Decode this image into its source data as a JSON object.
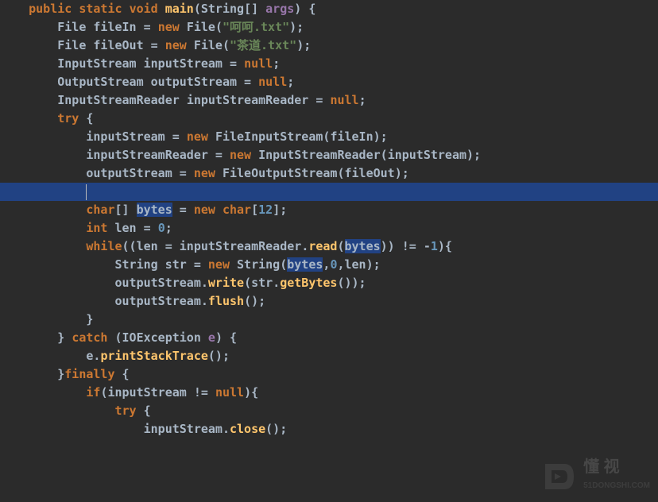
{
  "colors": {
    "background": "#2b2b2b",
    "keyword": "#cc7832",
    "string": "#6a8759",
    "number": "#6897bb",
    "method": "#ffc66d",
    "identifier": "#a9b7c6",
    "selection": "#214283",
    "highlight": "#32593d"
  },
  "cursor_position": {
    "line": 12,
    "column": 12
  },
  "highlighted_line": 12,
  "highlighted_identifier": "bytes",
  "code": {
    "lines": [
      {
        "indent": 4,
        "tokens": [
          [
            "kw",
            "public"
          ],
          [
            "sp",
            " "
          ],
          [
            "kw",
            "static"
          ],
          [
            "sp",
            " "
          ],
          [
            "kw",
            "void"
          ],
          [
            "sp",
            " "
          ],
          [
            "method",
            "main"
          ],
          [
            "punct",
            "("
          ],
          [
            "class",
            "String"
          ],
          [
            "punct",
            "[] "
          ],
          [
            "param",
            "args"
          ],
          [
            "punct",
            ") {"
          ]
        ]
      },
      {
        "indent": 8,
        "tokens": [
          [
            "class",
            "File"
          ],
          [
            "sp",
            " "
          ],
          [
            "ident",
            "fileIn"
          ],
          [
            "sp",
            " = "
          ],
          [
            "kw",
            "new"
          ],
          [
            "sp",
            " "
          ],
          [
            "class",
            "File"
          ],
          [
            "punct",
            "("
          ],
          [
            "str",
            "\"呵呵.txt\""
          ],
          [
            "punct",
            ");"
          ]
        ]
      },
      {
        "indent": 8,
        "tokens": [
          [
            "class",
            "File"
          ],
          [
            "sp",
            " "
          ],
          [
            "ident",
            "fileOut"
          ],
          [
            "sp",
            " = "
          ],
          [
            "kw",
            "new"
          ],
          [
            "sp",
            " "
          ],
          [
            "class",
            "File"
          ],
          [
            "punct",
            "("
          ],
          [
            "str",
            "\"茶道.txt\""
          ],
          [
            "punct",
            ");"
          ]
        ]
      },
      {
        "indent": 0,
        "tokens": []
      },
      {
        "indent": 8,
        "tokens": [
          [
            "class",
            "InputStream"
          ],
          [
            "sp",
            " "
          ],
          [
            "ident",
            "inputStream"
          ],
          [
            "sp",
            " = "
          ],
          [
            "kw",
            "null"
          ],
          [
            "punct",
            ";"
          ]
        ]
      },
      {
        "indent": 8,
        "tokens": [
          [
            "class",
            "OutputStream"
          ],
          [
            "sp",
            " "
          ],
          [
            "ident",
            "outputStream"
          ],
          [
            "sp",
            " = "
          ],
          [
            "kw",
            "null"
          ],
          [
            "punct",
            ";"
          ]
        ]
      },
      {
        "indent": 8,
        "tokens": [
          [
            "class",
            "InputStreamReader"
          ],
          [
            "sp",
            " "
          ],
          [
            "ident",
            "inputStreamReader"
          ],
          [
            "sp",
            " = "
          ],
          [
            "kw",
            "null"
          ],
          [
            "punct",
            ";"
          ]
        ]
      },
      {
        "indent": 0,
        "tokens": []
      },
      {
        "indent": 8,
        "tokens": [
          [
            "kw",
            "try"
          ],
          [
            "sp",
            " {"
          ]
        ]
      },
      {
        "indent": 12,
        "tokens": [
          [
            "ident",
            "inputStream"
          ],
          [
            "sp",
            " = "
          ],
          [
            "kw",
            "new"
          ],
          [
            "sp",
            " "
          ],
          [
            "class",
            "FileInputStream"
          ],
          [
            "punct",
            "("
          ],
          [
            "ident",
            "fileIn"
          ],
          [
            "punct",
            ");"
          ]
        ]
      },
      {
        "indent": 12,
        "tokens": [
          [
            "ident",
            "inputStreamReader"
          ],
          [
            "sp",
            " = "
          ],
          [
            "kw",
            "new"
          ],
          [
            "sp",
            " "
          ],
          [
            "class",
            "InputStreamReader"
          ],
          [
            "punct",
            "("
          ],
          [
            "ident",
            "inputStream"
          ],
          [
            "punct",
            ");"
          ]
        ]
      },
      {
        "indent": 12,
        "tokens": [
          [
            "ident",
            "outputStream"
          ],
          [
            "sp",
            " = "
          ],
          [
            "kw",
            "new"
          ],
          [
            "sp",
            " "
          ],
          [
            "class",
            "FileOutputStream"
          ],
          [
            "punct",
            "("
          ],
          [
            "ident",
            "fileOut"
          ],
          [
            "punct",
            ");"
          ]
        ]
      },
      {
        "indent": 12,
        "tokens": [],
        "highlighted": true,
        "cursor": true
      },
      {
        "indent": 12,
        "tokens": [
          [
            "kw",
            "char"
          ],
          [
            "punct",
            "[] "
          ],
          [
            "hl-var",
            "bytes"
          ],
          [
            "sp",
            " = "
          ],
          [
            "kw",
            "new"
          ],
          [
            "sp",
            " "
          ],
          [
            "kw",
            "char"
          ],
          [
            "punct",
            "["
          ],
          [
            "num",
            "12"
          ],
          [
            "punct",
            "];"
          ]
        ]
      },
      {
        "indent": 12,
        "tokens": [
          [
            "kw",
            "int"
          ],
          [
            "sp",
            " "
          ],
          [
            "ident",
            "len"
          ],
          [
            "sp",
            " = "
          ],
          [
            "num",
            "0"
          ],
          [
            "punct",
            ";"
          ]
        ]
      },
      {
        "indent": 0,
        "tokens": []
      },
      {
        "indent": 12,
        "tokens": [
          [
            "kw",
            "while"
          ],
          [
            "punct",
            "(("
          ],
          [
            "ident",
            "len"
          ],
          [
            "sp",
            " = "
          ],
          [
            "ident",
            "inputStreamReader"
          ],
          [
            "punct",
            "."
          ],
          [
            "method",
            "read"
          ],
          [
            "punct",
            "("
          ],
          [
            "hl-usage",
            "bytes"
          ],
          [
            "punct",
            ")) != -"
          ],
          [
            "num",
            "1"
          ],
          [
            "punct",
            "){"
          ]
        ]
      },
      {
        "indent": 16,
        "tokens": [
          [
            "class",
            "String"
          ],
          [
            "sp",
            " "
          ],
          [
            "ident",
            "str"
          ],
          [
            "sp",
            " = "
          ],
          [
            "kw",
            "new"
          ],
          [
            "sp",
            " "
          ],
          [
            "class",
            "String"
          ],
          [
            "punct",
            "("
          ],
          [
            "hl-usage",
            "bytes"
          ],
          [
            "punct",
            ","
          ],
          [
            "num",
            "0"
          ],
          [
            "punct",
            ","
          ],
          [
            "ident",
            "len"
          ],
          [
            "punct",
            ");"
          ]
        ]
      },
      {
        "indent": 0,
        "tokens": []
      },
      {
        "indent": 16,
        "tokens": [
          [
            "ident",
            "outputStream"
          ],
          [
            "punct",
            "."
          ],
          [
            "method",
            "write"
          ],
          [
            "punct",
            "("
          ],
          [
            "ident",
            "str"
          ],
          [
            "punct",
            "."
          ],
          [
            "method",
            "getBytes"
          ],
          [
            "punct",
            "());"
          ]
        ]
      },
      {
        "indent": 16,
        "tokens": [
          [
            "ident",
            "outputStream"
          ],
          [
            "punct",
            "."
          ],
          [
            "method",
            "flush"
          ],
          [
            "punct",
            "();"
          ]
        ]
      },
      {
        "indent": 12,
        "tokens": [
          [
            "punct",
            "}"
          ]
        ]
      },
      {
        "indent": 8,
        "tokens": [
          [
            "punct",
            "} "
          ],
          [
            "kw",
            "catch"
          ],
          [
            "sp",
            " ("
          ],
          [
            "class",
            "IOException"
          ],
          [
            "sp",
            " "
          ],
          [
            "param",
            "e"
          ],
          [
            "punct",
            ") {"
          ]
        ]
      },
      {
        "indent": 12,
        "tokens": [
          [
            "ident",
            "e"
          ],
          [
            "punct",
            "."
          ],
          [
            "method",
            "printStackTrace"
          ],
          [
            "punct",
            "();"
          ]
        ]
      },
      {
        "indent": 8,
        "tokens": [
          [
            "punct",
            "}"
          ],
          [
            "kw",
            "finally"
          ],
          [
            "sp",
            " {"
          ]
        ]
      },
      {
        "indent": 12,
        "tokens": [
          [
            "kw",
            "if"
          ],
          [
            "punct",
            "("
          ],
          [
            "ident",
            "inputStream"
          ],
          [
            "sp",
            " != "
          ],
          [
            "kw",
            "null"
          ],
          [
            "punct",
            "){"
          ]
        ]
      },
      {
        "indent": 16,
        "tokens": [
          [
            "kw",
            "try"
          ],
          [
            "sp",
            " {"
          ]
        ]
      },
      {
        "indent": 20,
        "tokens": [
          [
            "ident",
            "inputStream"
          ],
          [
            "punct",
            "."
          ],
          [
            "method",
            "close"
          ],
          [
            "punct",
            "();"
          ]
        ]
      }
    ]
  },
  "watermark": {
    "text": "懂 视",
    "subtext": "51DONGSHI.COM"
  }
}
